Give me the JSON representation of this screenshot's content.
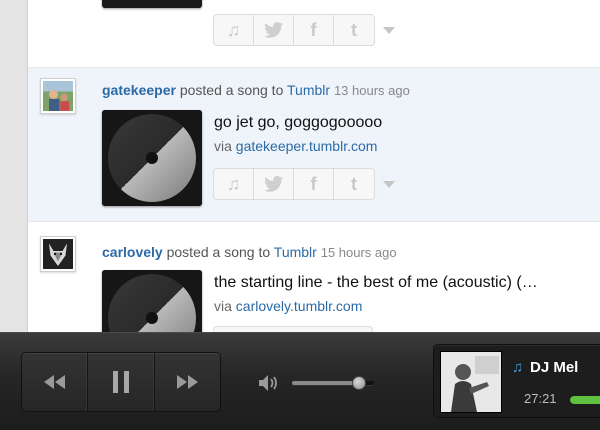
{
  "feed": {
    "posts": [
      {
        "user": "gatekeeper",
        "action": "posted a song to",
        "service": "Tumblr",
        "time": "13 hours ago",
        "song_title": "go jet go, goggogooooo",
        "via_prefix": "via",
        "via_link": "gatekeeper.tumblr.com"
      },
      {
        "user": "carlovely",
        "action": "posted a song to",
        "service": "Tumblr",
        "time": "15 hours ago",
        "song_title": "the starting line - the best of me (acoustic) (…",
        "via_prefix": "via",
        "via_link": "carlovely.tumblr.com"
      }
    ],
    "share_icons": [
      "music-note-icon",
      "twitter-bird-icon",
      "facebook-f-icon",
      "tumblr-t-icon",
      "chevron-down-icon"
    ],
    "share_glyphs": {
      "facebook": "f",
      "tumblr": "t"
    }
  },
  "player": {
    "now_playing_title": "DJ Mel",
    "elapsed": "27:21",
    "volume_level": 0.82,
    "track_progress": 0.55,
    "accent_color": "#3c9bd9",
    "progress_color": "#5cc23f"
  }
}
